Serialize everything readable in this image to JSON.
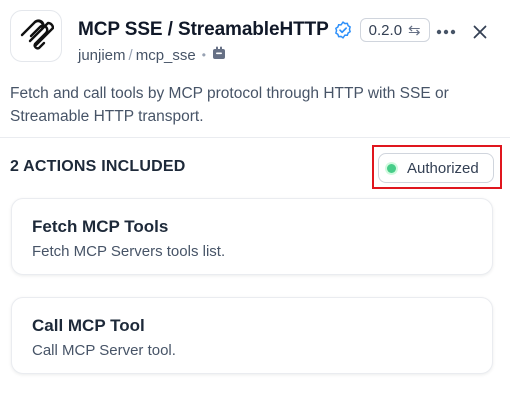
{
  "header": {
    "title": "MCP SSE / StreamableHTTP",
    "version": "0.2.0",
    "author": "junjiem",
    "separator": "/",
    "package": "mcp_sse"
  },
  "description": "Fetch and call tools by MCP protocol through HTTP with SSE or Streamable HTTP transport.",
  "actions_section": {
    "title": "2 ACTIONS INCLUDED",
    "auth_status": "Authorized"
  },
  "actions": [
    {
      "title": "Fetch MCP Tools",
      "description": "Fetch MCP Servers tools list."
    },
    {
      "title": "Call MCP Tool",
      "description": "Call MCP Server tool."
    }
  ],
  "colors": {
    "verified": "#2e90fa",
    "authorized_dot": "#47cd89",
    "highlight_box": "#e0161e"
  },
  "icons": {
    "logo": "mcp-logo-icon",
    "verified": "verified-badge-icon",
    "version_switch": "swap-icon",
    "package": "package-icon",
    "more": "more-icon",
    "close": "close-icon"
  }
}
